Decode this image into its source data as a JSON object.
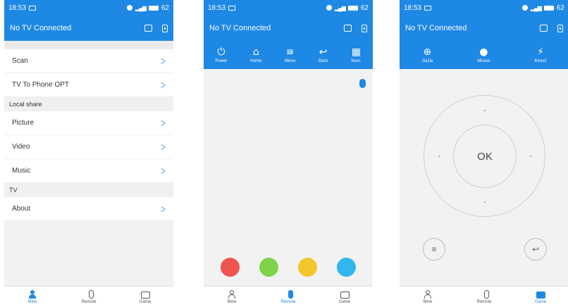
{
  "status": {
    "time": "18:53",
    "battery": "62"
  },
  "appbar": {
    "title": "No TV Connected"
  },
  "mine": {
    "rows1": [
      {
        "label": "Scan"
      },
      {
        "label": "TV To Phone OPT"
      }
    ],
    "section_local": "Local share",
    "rows2": [
      {
        "label": "Picture"
      },
      {
        "label": "Video"
      },
      {
        "label": "Music"
      }
    ],
    "section_tv": "TV",
    "rows3": [
      {
        "label": "About"
      }
    ]
  },
  "tabs": {
    "mine": "Mine",
    "remote": "Remote",
    "game": "Game"
  },
  "remote": {
    "tools": {
      "power": "Power",
      "home": "Home",
      "menu": "Menu",
      "back": "Back",
      "num": "Num."
    },
    "colors": [
      "#ef5350",
      "#7ed348",
      "#f2c62c",
      "#2fb7ee"
    ]
  },
  "game": {
    "tools": {
      "jiajia": "JiaJia",
      "mouse": "Mouse",
      "kinect": "Kinect"
    },
    "ok_label": "OK"
  },
  "accent": "#1e88e5"
}
